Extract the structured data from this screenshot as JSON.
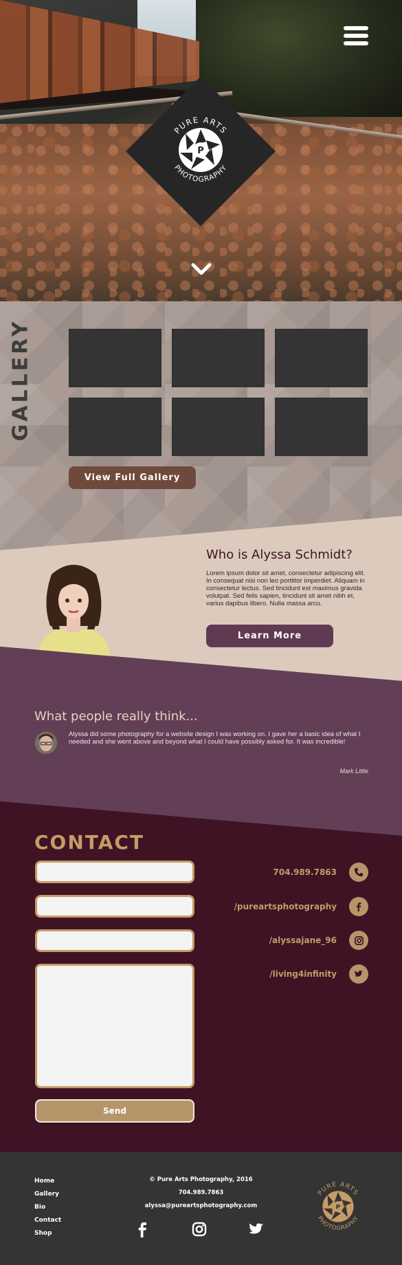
{
  "hero": {
    "logo_top_text": "PURE ARTS",
    "logo_bottom_text": "PHOTOGRAPHY",
    "logo_letter": "P",
    "menu_icon": "hamburger-menu-icon",
    "scroll_icon": "chevron-down-icon"
  },
  "gallery": {
    "title": "GALLERY",
    "thumbnail_count": 6,
    "button_label": "View Full Gallery"
  },
  "about": {
    "title": "Who is Alyssa Schmidt?",
    "text": "Lorem ipsum dolor sit amet, consectetur adipiscing elit. In consequat nisi non leo porttitor imperdiet. Aliquam in consectetur lectus. Sed tincidunt est maximus gravida volutpat. Sed felis sapien, tincidunt sit amet nibh et, varius dapibus libero. Nulla massa arcu.",
    "button_label": "Learn More"
  },
  "testimonial": {
    "title": "What people really think...",
    "quote": "Alyssa did some photography for a website design I was working on. I gave her a basic idea of what I needed and she went above and beyond what I could have possibly asked for. It was incredible!",
    "author": "Mark Little"
  },
  "contact": {
    "title": "CONTACT",
    "send_label": "Send",
    "items": [
      {
        "label": "704.989.7863",
        "icon": "phone-icon"
      },
      {
        "label": "/pureartsphotography",
        "icon": "facebook-icon"
      },
      {
        "label": "/alyssajane_96",
        "icon": "instagram-icon"
      },
      {
        "label": "/living4infinity",
        "icon": "twitter-icon"
      }
    ]
  },
  "footer": {
    "nav": [
      "Home",
      "Gallery",
      "Bio",
      "Contact",
      "Shop"
    ],
    "copyright": "© Pure Arts Photography, 2016",
    "phone": "704.989.7863",
    "email": "alyssa@pureartsphotography.com",
    "social_icons": [
      "facebook-icon",
      "instagram-icon",
      "twitter-icon"
    ],
    "logo_top_text": "PURE ARTS",
    "logo_bottom_text": "PHOTOGRAPHY",
    "logo_letter": "P"
  },
  "colors": {
    "gold": "#c59b66",
    "plum": "#5f3a52",
    "wine": "#3f1224",
    "brown_button": "#6f4a3c",
    "footer": "#343434"
  }
}
